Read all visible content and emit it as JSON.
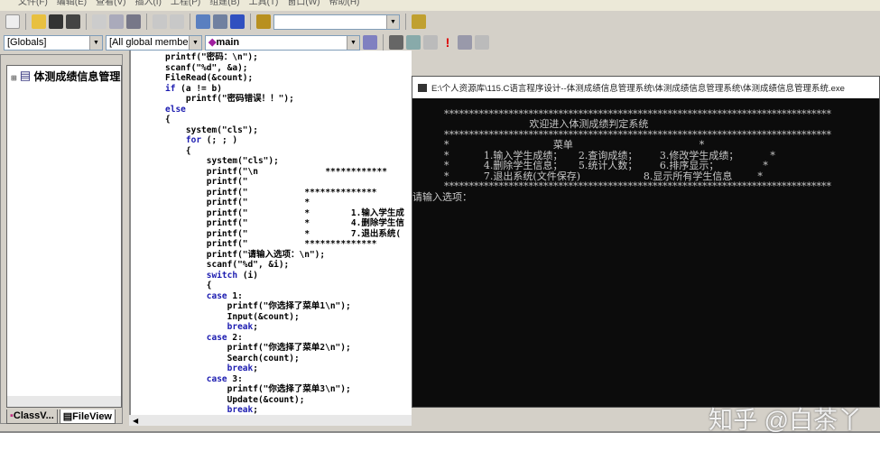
{
  "menu": [
    "文件(F)",
    "编辑(E)",
    "查看(V)",
    "插入(I)",
    "工程(P)",
    "组建(B)",
    "工具(T)",
    "窗口(W)",
    "帮助(H)"
  ],
  "toolbar": {
    "globals": "[Globals]",
    "members": "[All global members]",
    "function": "main",
    "find_value": ""
  },
  "class_view": {
    "root": "体测成绩信息管理",
    "tabs": [
      "ClassV...",
      "FileView"
    ]
  },
  "code": [
    {
      "i": 0,
      "p": [
        [
          "printf(\"密码：\\n\");",
          0
        ]
      ]
    },
    {
      "i": 0,
      "p": [
        [
          "scanf(\"%d\", &a);",
          0
        ]
      ]
    },
    {
      "i": 0,
      "p": [
        [
          "FileRead(&count);",
          0
        ]
      ]
    },
    {
      "i": 0,
      "p": [
        [
          "if",
          1
        ],
        [
          " (a != b)",
          0
        ]
      ]
    },
    {
      "i": 1,
      "p": [
        [
          "printf(\"密码错误！！\");",
          0
        ]
      ]
    },
    {
      "i": 0,
      "p": [
        [
          "else",
          1
        ]
      ]
    },
    {
      "i": 0,
      "p": [
        [
          "{",
          0
        ]
      ]
    },
    {
      "i": 1,
      "p": [
        [
          "system(\"cls\");",
          0
        ]
      ]
    },
    {
      "i": 1,
      "p": [
        [
          "for",
          1
        ],
        [
          " (; ; )",
          0
        ]
      ]
    },
    {
      "i": 1,
      "p": [
        [
          "{",
          0
        ]
      ]
    },
    {
      "i": 2,
      "p": [
        [
          "system(\"cls\");",
          0
        ]
      ]
    },
    {
      "i": 2,
      "p": [
        [
          "printf(\"\\n             ************",
          0
        ]
      ]
    },
    {
      "i": 2,
      "p": [
        [
          "printf(\"",
          0
        ]
      ]
    },
    {
      "i": 2,
      "p": [
        [
          "printf(\"           **************",
          0
        ]
      ]
    },
    {
      "i": 2,
      "p": [
        [
          "printf(\"           *",
          0
        ]
      ]
    },
    {
      "i": 2,
      "p": [
        [
          "printf(\"           *        1.输入学生成",
          0
        ]
      ]
    },
    {
      "i": 2,
      "p": [
        [
          "printf(\"           *        4.删除学生信",
          0
        ]
      ]
    },
    {
      "i": 2,
      "p": [
        [
          "printf(\"           *        7.退出系统(",
          0
        ]
      ]
    },
    {
      "i": 2,
      "p": [
        [
          "printf(\"           **************",
          0
        ]
      ]
    },
    {
      "i": 2,
      "p": [
        [
          "printf(\"请输入选项：\\n\");",
          0
        ]
      ]
    },
    {
      "i": 2,
      "p": [
        [
          "scanf(\"%d\", &i);",
          0
        ]
      ]
    },
    {
      "i": 2,
      "p": [
        [
          "switch",
          1
        ],
        [
          " (i)",
          0
        ]
      ]
    },
    {
      "i": 2,
      "p": [
        [
          "{",
          0
        ]
      ]
    },
    {
      "i": 2,
      "p": [
        [
          "case",
          1
        ],
        [
          " 1:",
          0
        ]
      ]
    },
    {
      "i": 3,
      "p": [
        [
          "printf(\"你选择了菜单1\\n\");",
          0
        ]
      ]
    },
    {
      "i": 3,
      "p": [
        [
          "Input(&count);",
          0
        ]
      ]
    },
    {
      "i": 3,
      "p": [
        [
          "break",
          1
        ],
        [
          ";",
          0
        ]
      ]
    },
    {
      "i": 2,
      "p": [
        [
          "case",
          1
        ],
        [
          " 2:",
          0
        ]
      ]
    },
    {
      "i": 3,
      "p": [
        [
          "printf(\"你选择了菜单2\\n\");",
          0
        ]
      ]
    },
    {
      "i": 3,
      "p": [
        [
          "Search(count);",
          0
        ]
      ]
    },
    {
      "i": 3,
      "p": [
        [
          "break",
          1
        ],
        [
          ";",
          0
        ]
      ]
    },
    {
      "i": 2,
      "p": [
        [
          "case",
          1
        ],
        [
          " 3:",
          0
        ]
      ]
    },
    {
      "i": 3,
      "p": [
        [
          "printf(\"你选择了菜单3\\n\");",
          0
        ]
      ]
    },
    {
      "i": 3,
      "p": [
        [
          "Update(&count);",
          0
        ]
      ]
    },
    {
      "i": 3,
      "p": [
        [
          "break",
          1
        ],
        [
          ";",
          0
        ]
      ]
    }
  ],
  "console": {
    "title": "E:\\个人资源库\\115.C语言程序设计--体测成绩信息管理系统\\体测成绩信息管理系统\\体测成绩信息管理系统.exe",
    "lines": [
      "",
      "          ******************************************************************************",
      "                                     欢迎进入体测成绩判定系统",
      "          ******************************************************************************",
      "          *                                 菜单                                        *",
      "          *           1.输入学生成绩；     2.查询成绩；       3.修改学生成绩；          *",
      "          *           4.删除学生信息；     5.统计人数；       6.排序显示；              *",
      "          *           7.退出系统(文件保存)                    8.显示所有学生信息        *",
      "          ******************************************************************************",
      "请输入选项："
    ]
  },
  "watermark": "知乎 @白茶丫",
  "colors": {
    "keyword": "#1b1bb0",
    "console_bg": "#0c0c0c"
  }
}
